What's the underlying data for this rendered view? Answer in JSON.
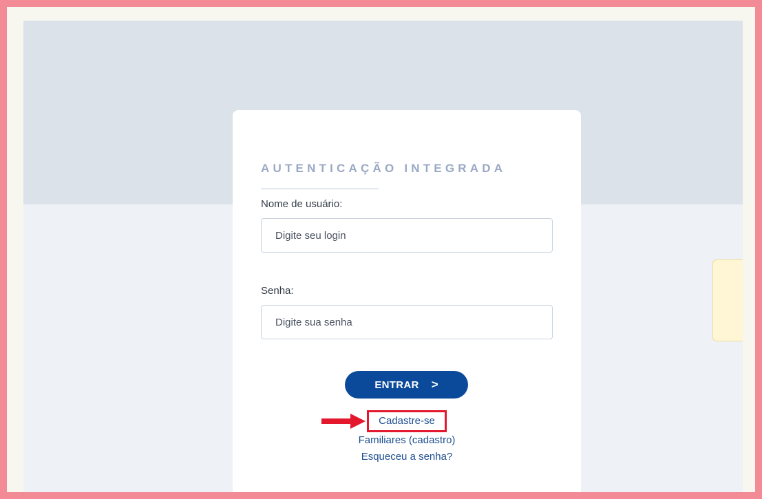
{
  "card": {
    "title": "AUTENTICAÇÃO INTEGRADA"
  },
  "form": {
    "username_label": "Nome de usuário:",
    "username_placeholder": "Digite seu login",
    "password_label": "Senha:",
    "password_placeholder": "Digite sua senha",
    "submit_label": "ENTRAR",
    "submit_icon": ">"
  },
  "links": {
    "register": "Cadastre-se",
    "family_register": "Familiares (cadastro)",
    "forgot_password": "Esqueceu a senha?"
  },
  "colors": {
    "outer_border": "#f28b96",
    "primary_button": "#0b4a9a",
    "link": "#1c4e8f",
    "highlight_box": "#e3182d",
    "title": "#9aa9c4"
  },
  "annotations": {
    "arrow_icon": "red-arrow-right-icon"
  }
}
